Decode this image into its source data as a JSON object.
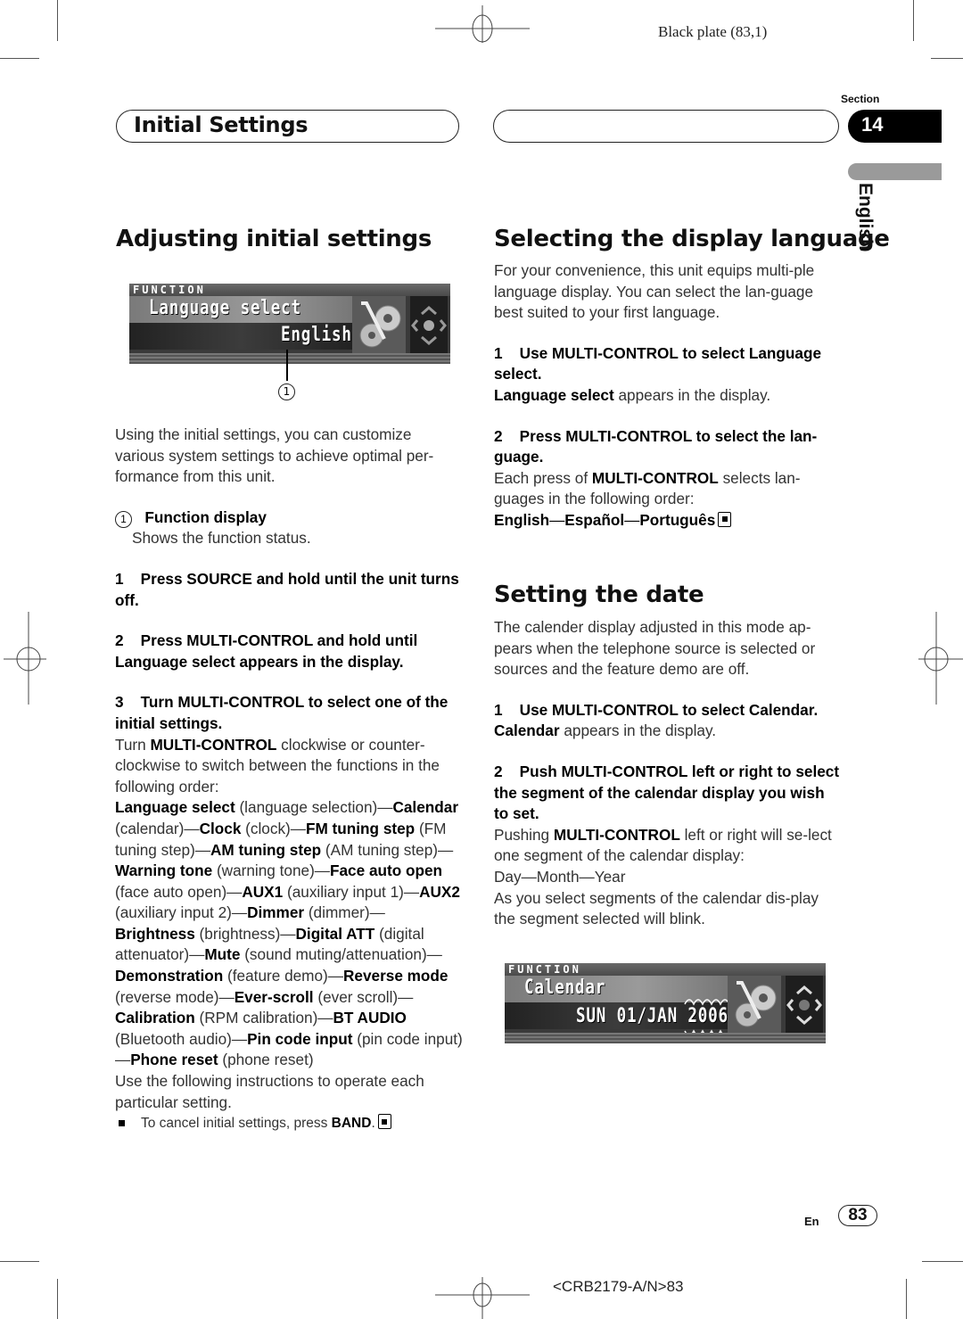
{
  "print_marks": {
    "plate_label": "Black plate (83,1)",
    "doc_code": "<CRB2179-A/N>83"
  },
  "header": {
    "title": "Initial Settings",
    "section_label": "Section",
    "section_number": "14",
    "language_tab": "English"
  },
  "left_column": {
    "heading": "Adjusting initial settings",
    "display": {
      "function_label": "FUNCTION",
      "line1": "Language select",
      "line2": "English",
      "callout_number": "1"
    },
    "intro": "Using the initial settings, you can customize various system settings to achieve optimal per-formance from this unit.",
    "callout_item": {
      "number": "1",
      "title": "Function display",
      "description": "Shows the function status."
    },
    "steps": [
      {
        "number": "1",
        "text": "Press SOURCE and hold until the unit turns off."
      },
      {
        "number": "2",
        "text": "Press MULTI-CONTROL and hold until Language select appears in the display."
      },
      {
        "number": "3",
        "text": "Turn MULTI-CONTROL to select one of the initial settings."
      }
    ],
    "step3_body": {
      "prefix": "Turn ",
      "bold": "MULTI-CONTROL",
      "suffix": " clockwise or counter-clockwise to switch between the functions in the following order:"
    },
    "settings_order": [
      {
        "name": "Language select",
        "desc": "(language selection)"
      },
      {
        "name": "Calendar",
        "desc": "(calendar)"
      },
      {
        "name": "Clock",
        "desc": "(clock)"
      },
      {
        "name": "FM tuning step",
        "desc": "(FM tuning step)"
      },
      {
        "name": "AM tuning step",
        "desc": "(AM tuning step)"
      },
      {
        "name": "Warning tone",
        "desc": "(warning tone)"
      },
      {
        "name": "Face auto open",
        "desc": "(face auto open)"
      },
      {
        "name": "AUX1",
        "desc": "(auxiliary input 1)"
      },
      {
        "name": "AUX2",
        "desc": "(auxiliary input 2)"
      },
      {
        "name": "Dimmer",
        "desc": "(dimmer)"
      },
      {
        "name": "Brightness",
        "desc": "(brightness)"
      },
      {
        "name": "Digital ATT",
        "desc": "(digital attenuator)"
      },
      {
        "name": "Mute",
        "desc": "(sound muting/attenuation)"
      },
      {
        "name": "Demonstration",
        "desc": "(feature demo)"
      },
      {
        "name": "Reverse mode",
        "desc": "(reverse mode)"
      },
      {
        "name": "Ever-scroll",
        "desc": "(ever scroll)"
      },
      {
        "name": "Calibration",
        "desc": "(RPM calibration)"
      },
      {
        "name": "BT AUDIO",
        "desc": "(Bluetooth audio)"
      },
      {
        "name": "Pin code input",
        "desc": "(pin code input)"
      },
      {
        "name": "Phone reset",
        "desc": "(phone reset)"
      }
    ],
    "instructions_note": "Use the following instructions to operate each particular setting.",
    "cancel_note": {
      "prefix": "To cancel initial settings, press ",
      "bold": "BAND",
      "suffix": "."
    }
  },
  "right_column": {
    "language_section": {
      "heading": "Selecting the display language",
      "intro": "For your convenience, this unit equips multi-ple language display. You can select the lan-guage best suited to your first language.",
      "step1": {
        "number": "1",
        "text": "Use MULTI-CONTROL to select Language select."
      },
      "step1_body": {
        "bold": "Language select",
        "text": " appears in the display."
      },
      "step2": {
        "number": "2",
        "text": "Press MULTI-CONTROL to select the lan-guage."
      },
      "step2_body": {
        "prefix": "Each press of ",
        "bold": "MULTI-CONTROL",
        "suffix": " selects lan-guages in the following order:"
      },
      "languages": [
        "English",
        "Español",
        "Português"
      ]
    },
    "date_section": {
      "heading": "Setting the date",
      "intro": "The calender display adjusted in this mode ap-pears when the telephone source is selected or sources and the feature demo are off.",
      "step1": {
        "number": "1",
        "text": "Use MULTI-CONTROL to select Calendar."
      },
      "step1_body": {
        "bold": "Calendar",
        "text": " appears in the display."
      },
      "step2": {
        "number": "2",
        "text": "Push MULTI-CONTROL left or right to select the segment of the calendar display you wish to set."
      },
      "step2_body": {
        "prefix": "Pushing ",
        "bold": "MULTI-CONTROL",
        "suffix": " left or right will se-lect one segment of the calendar display:"
      },
      "segments": "Day—Month—Year",
      "blink_note": "As you select segments of the calendar dis-play the segment selected will blink.",
      "display": {
        "function_label": "FUNCTION",
        "line1": "Calendar",
        "line2": "SUN 01/JAN 2006"
      }
    }
  },
  "footer": {
    "lang_code": "En",
    "page_number": "83"
  }
}
